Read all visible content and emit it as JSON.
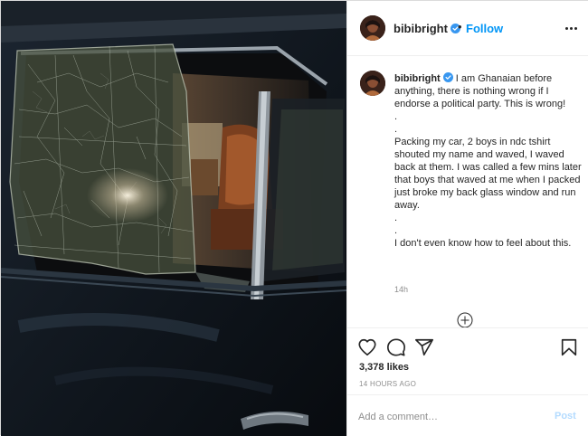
{
  "post_image": {
    "description_icon": "shattered-car-window-photo"
  },
  "header": {
    "username": "bibibright",
    "verified_icon": "verified-badge-icon",
    "separator": "•",
    "follow_label": "Follow",
    "more_icon": "more-options-icon"
  },
  "caption": {
    "username": "bibibright",
    "text": " I am Ghanaian before anything, there is nothing wrong if I endorse a political party. This is wrong!\n.\n.\nPacking my car, 2 boys in ndc tshirt shouted my name and waved, I waved back at them. I was called a few mins later that boys that waved at me when I packed just broke my back glass window and run away.\n.\n.\nI don't even know how to feel about this.",
    "time": "14h"
  },
  "actions": {
    "icons": [
      "heart-icon",
      "comment-icon",
      "share-icon",
      "bookmark-icon"
    ],
    "likes": "3,378 likes",
    "date": "14 HOURS AGO"
  },
  "comment_box": {
    "placeholder": "Add a comment…",
    "post_label": "Post"
  },
  "colors": {
    "accent": "#0095f6",
    "post_disabled": "#b3dbff",
    "muted": "#8e8e8e",
    "text": "#262626",
    "divider": "#efefef"
  }
}
